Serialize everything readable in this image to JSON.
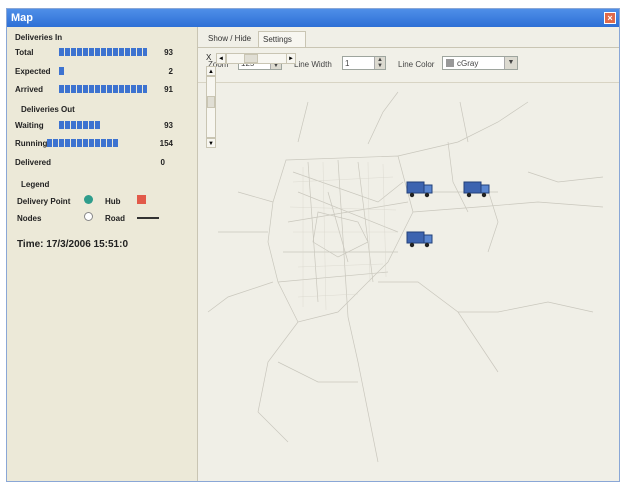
{
  "window": {
    "title": "Map",
    "close_glyph": "×"
  },
  "sidebar": {
    "deliveries_in": {
      "header": "Deliveries In",
      "rows": [
        {
          "label": "Total",
          "value": "93",
          "fill": 0.8
        },
        {
          "label": "Expected",
          "value": "2",
          "fill": 0.05
        },
        {
          "label": "Arrived",
          "value": "91",
          "fill": 0.8
        }
      ]
    },
    "deliveries_out": {
      "header": "Deliveries Out",
      "rows": [
        {
          "label": "Waiting",
          "value": "93",
          "fill": 0.38
        },
        {
          "label": "Running",
          "value": "154",
          "fill": 0.57
        },
        {
          "label": "Delivered",
          "value": "0",
          "fill": 0
        }
      ]
    },
    "legend": {
      "header": "Legend",
      "delivery_point": "Delivery Point",
      "hub": "Hub",
      "nodes": "Nodes",
      "road": "Road",
      "delivery_point_color": "#2f9d8c",
      "hub_color": "#e25a4a"
    },
    "time": "Time: 17/3/2006 15:51:0"
  },
  "tabs": [
    {
      "label": "Show / Hide"
    },
    {
      "label": "Settings"
    }
  ],
  "settings": {
    "zoom_label": "Zoom",
    "zoom_value": "125",
    "line_width_label": "Line Width",
    "line_width_value": "1",
    "line_color_label": "Line Color",
    "line_color_value": "cGray"
  },
  "map_controls": {
    "close": "X",
    "left": "◄",
    "right": "►",
    "up": "▲",
    "down": "▼"
  },
  "icons": {
    "truck": "truck-icon",
    "spin": "spin-arrows-icon"
  },
  "trucks": [
    {},
    {},
    {}
  ]
}
